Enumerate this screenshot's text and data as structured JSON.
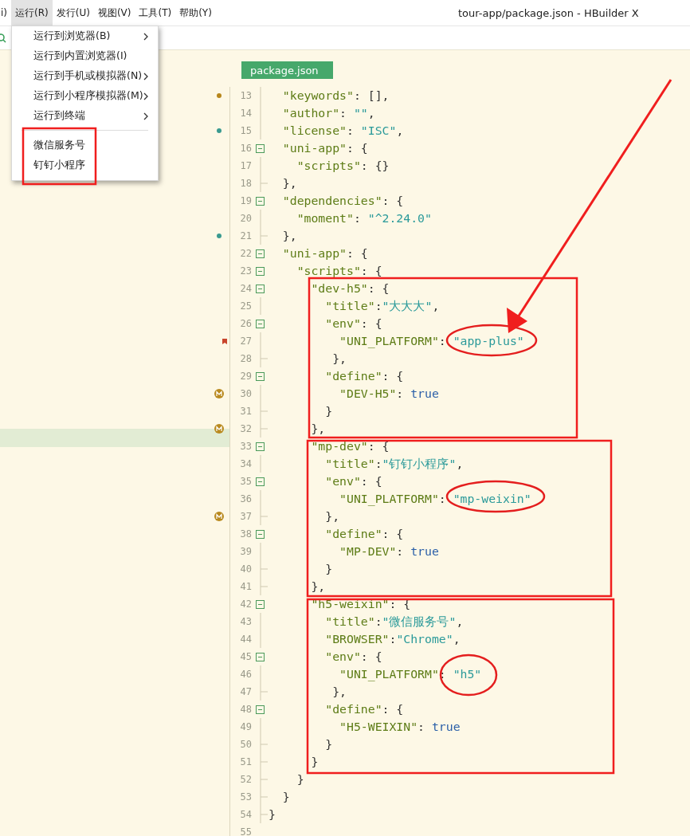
{
  "window": {
    "title": "tour-app/package.json - HBuilder X"
  },
  "menu_bar": [
    {
      "label": "i)",
      "selected": false
    },
    {
      "label": "运行(R)",
      "selected": true
    },
    {
      "label": "发行(U)",
      "selected": false
    },
    {
      "label": "视图(V)",
      "selected": false
    },
    {
      "label": "工具(T)",
      "selected": false
    },
    {
      "label": "帮助(Y)",
      "selected": false
    }
  ],
  "dropdown": {
    "groups": [
      [
        {
          "label": "运行到浏览器(B)",
          "submenu": true
        },
        {
          "label": "运行到内置浏览器(I)",
          "submenu": false
        },
        {
          "label": "运行到手机或模拟器(N)",
          "submenu": true
        },
        {
          "label": "运行到小程序模拟器(M)",
          "submenu": true
        },
        {
          "label": "运行到终端",
          "submenu": true
        }
      ],
      [
        {
          "label": "微信服务号",
          "submenu": false
        },
        {
          "label": "钉钉小程序",
          "submenu": false
        }
      ]
    ]
  },
  "sidebar": {
    "highlighted_row": true
  },
  "editor": {
    "tab": "package.json",
    "lines": [
      {
        "num": "13",
        "fold": {
          "kind": "mid"
        },
        "marker": {
          "kind": "dot",
          "color": "#b7861b"
        },
        "tokens": [
          {
            "kind": "key",
            "text": "  \"keywords\""
          },
          {
            "kind": "punct",
            "text": ": [],"
          }
        ]
      },
      {
        "num": "14",
        "fold": {
          "kind": "mid"
        },
        "tokens": [
          {
            "kind": "key",
            "text": "  \"author\""
          },
          {
            "kind": "punct",
            "text": ": "
          },
          {
            "kind": "str",
            "text": "\"\""
          },
          {
            "kind": "punct",
            "text": ","
          }
        ]
      },
      {
        "num": "15",
        "fold": {
          "kind": "mid"
        },
        "marker": {
          "kind": "dot",
          "color": "#3a9a90"
        },
        "tokens": [
          {
            "kind": "key",
            "text": "  \"license\""
          },
          {
            "kind": "punct",
            "text": ": "
          },
          {
            "kind": "str",
            "text": "\"ISC\""
          },
          {
            "kind": "punct",
            "text": ","
          }
        ]
      },
      {
        "num": "16",
        "fold": {
          "kind": "start"
        },
        "tokens": [
          {
            "kind": "key",
            "text": "  \"uni-app\""
          },
          {
            "kind": "punct",
            "text": ": {"
          }
        ]
      },
      {
        "num": "17",
        "fold": {
          "kind": "mid"
        },
        "tokens": [
          {
            "kind": "key",
            "text": "    \"scripts\""
          },
          {
            "kind": "punct",
            "text": ": {}"
          }
        ]
      },
      {
        "num": "18",
        "fold": {
          "kind": "end"
        },
        "tokens": [
          {
            "kind": "punct",
            "text": "  },"
          }
        ]
      },
      {
        "num": "19",
        "fold": {
          "kind": "start"
        },
        "tokens": [
          {
            "kind": "key",
            "text": "  \"dependencies\""
          },
          {
            "kind": "punct",
            "text": ": {"
          }
        ]
      },
      {
        "num": "20",
        "fold": {
          "kind": "mid"
        },
        "tokens": [
          {
            "kind": "key",
            "text": "    \"moment\""
          },
          {
            "kind": "punct",
            "text": ": "
          },
          {
            "kind": "str",
            "text": "\"^2.24.0\""
          }
        ]
      },
      {
        "num": "21",
        "fold": {
          "kind": "end"
        },
        "marker": {
          "kind": "dot",
          "color": "#3a9a90"
        },
        "tokens": [
          {
            "kind": "punct",
            "text": "  },"
          }
        ]
      },
      {
        "num": "22",
        "fold": {
          "kind": "start"
        },
        "tokens": [
          {
            "kind": "key",
            "text": "  \"uni-app\""
          },
          {
            "kind": "punct",
            "text": ": {"
          }
        ]
      },
      {
        "num": "23",
        "fold": {
          "kind": "start"
        },
        "tokens": [
          {
            "kind": "key",
            "text": "    \"scripts\""
          },
          {
            "kind": "punct",
            "text": ": {"
          }
        ]
      },
      {
        "num": "24",
        "fold": {
          "kind": "start"
        },
        "tokens": [
          {
            "kind": "key",
            "text": "      \"dev-h5\""
          },
          {
            "kind": "punct",
            "text": ": {"
          }
        ]
      },
      {
        "num": "25",
        "fold": {
          "kind": "mid"
        },
        "tokens": [
          {
            "kind": "key",
            "text": "        \"title\""
          },
          {
            "kind": "punct",
            "text": ":"
          },
          {
            "kind": "str",
            "text": "\"大大大\""
          },
          {
            "kind": "punct",
            "text": ","
          }
        ]
      },
      {
        "num": "26",
        "fold": {
          "kind": "start"
        },
        "tokens": [
          {
            "kind": "key",
            "text": "        \"env\""
          },
          {
            "kind": "punct",
            "text": ": {"
          }
        ]
      },
      {
        "num": "27",
        "fold": {
          "kind": "mid"
        },
        "marker": {
          "kind": "bookmark"
        },
        "tokens": [
          {
            "kind": "key",
            "text": "          \"UNI_PLATFORM\""
          },
          {
            "kind": "punct",
            "text": ": "
          },
          {
            "kind": "str",
            "text": "\"app-plus\""
          }
        ]
      },
      {
        "num": "28",
        "fold": {
          "kind": "end"
        },
        "tokens": [
          {
            "kind": "punct",
            "text": "         },"
          }
        ]
      },
      {
        "num": "29",
        "fold": {
          "kind": "start"
        },
        "tokens": [
          {
            "kind": "key",
            "text": "        \"define\""
          },
          {
            "kind": "punct",
            "text": ": {"
          }
        ]
      },
      {
        "num": "30",
        "fold": {
          "kind": "mid"
        },
        "marker": {
          "kind": "modified"
        },
        "tokens": [
          {
            "kind": "key",
            "text": "          \"DEV-H5\""
          },
          {
            "kind": "punct",
            "text": ": "
          },
          {
            "kind": "kw",
            "text": "true"
          }
        ]
      },
      {
        "num": "31",
        "fold": {
          "kind": "end"
        },
        "tokens": [
          {
            "kind": "punct",
            "text": "        }"
          }
        ]
      },
      {
        "num": "32",
        "fold": {
          "kind": "end"
        },
        "marker": {
          "kind": "modified"
        },
        "tokens": [
          {
            "kind": "punct",
            "text": "      },"
          }
        ]
      },
      {
        "num": "33",
        "fold": {
          "kind": "start"
        },
        "tokens": [
          {
            "kind": "key",
            "text": "      \"mp-dev\""
          },
          {
            "kind": "punct",
            "text": ": {"
          }
        ]
      },
      {
        "num": "34",
        "fold": {
          "kind": "mid"
        },
        "tokens": [
          {
            "kind": "key",
            "text": "        \"title\""
          },
          {
            "kind": "punct",
            "text": ":"
          },
          {
            "kind": "str",
            "text": "\"钉钉小程序\""
          },
          {
            "kind": "punct",
            "text": ","
          }
        ]
      },
      {
        "num": "35",
        "fold": {
          "kind": "start"
        },
        "tokens": [
          {
            "kind": "key",
            "text": "        \"env\""
          },
          {
            "kind": "punct",
            "text": ": {"
          }
        ]
      },
      {
        "num": "36",
        "fold": {
          "kind": "mid"
        },
        "tokens": [
          {
            "kind": "key",
            "text": "          \"UNI_PLATFORM\""
          },
          {
            "kind": "punct",
            "text": ": "
          },
          {
            "kind": "str",
            "text": "\"mp-weixin\""
          }
        ]
      },
      {
        "num": "37",
        "fold": {
          "kind": "end"
        },
        "marker": {
          "kind": "modified"
        },
        "tokens": [
          {
            "kind": "punct",
            "text": "        },"
          }
        ]
      },
      {
        "num": "38",
        "fold": {
          "kind": "start"
        },
        "tokens": [
          {
            "kind": "key",
            "text": "        \"define\""
          },
          {
            "kind": "punct",
            "text": ": {"
          }
        ]
      },
      {
        "num": "39",
        "fold": {
          "kind": "mid"
        },
        "tokens": [
          {
            "kind": "key",
            "text": "          \"MP-DEV\""
          },
          {
            "kind": "punct",
            "text": ": "
          },
          {
            "kind": "kw",
            "text": "true"
          }
        ]
      },
      {
        "num": "40",
        "fold": {
          "kind": "end"
        },
        "tokens": [
          {
            "kind": "punct",
            "text": "        }"
          }
        ]
      },
      {
        "num": "41",
        "fold": {
          "kind": "end"
        },
        "tokens": [
          {
            "kind": "punct",
            "text": "      },"
          }
        ]
      },
      {
        "num": "42",
        "fold": {
          "kind": "start"
        },
        "tokens": [
          {
            "kind": "key",
            "text": "      \"h5-weixin\""
          },
          {
            "kind": "punct",
            "text": ": {"
          }
        ]
      },
      {
        "num": "43",
        "fold": {
          "kind": "mid"
        },
        "tokens": [
          {
            "kind": "key",
            "text": "        \"title\""
          },
          {
            "kind": "punct",
            "text": ":"
          },
          {
            "kind": "str",
            "text": "\"微信服务号\""
          },
          {
            "kind": "punct",
            "text": ","
          }
        ]
      },
      {
        "num": "44",
        "fold": {
          "kind": "mid"
        },
        "tokens": [
          {
            "kind": "key",
            "text": "        \"BROWSER\""
          },
          {
            "kind": "punct",
            "text": ":"
          },
          {
            "kind": "str",
            "text": "\"Chrome\""
          },
          {
            "kind": "punct",
            "text": ","
          }
        ]
      },
      {
        "num": "45",
        "fold": {
          "kind": "start"
        },
        "tokens": [
          {
            "kind": "key",
            "text": "        \"env\""
          },
          {
            "kind": "punct",
            "text": ": {"
          }
        ]
      },
      {
        "num": "46",
        "fold": {
          "kind": "mid"
        },
        "tokens": [
          {
            "kind": "key",
            "text": "          \"UNI_PLATFORM\""
          },
          {
            "kind": "punct",
            "text": ": "
          },
          {
            "kind": "str",
            "text": "\"h5\""
          }
        ]
      },
      {
        "num": "47",
        "fold": {
          "kind": "end"
        },
        "tokens": [
          {
            "kind": "punct",
            "text": "         },"
          }
        ]
      },
      {
        "num": "48",
        "fold": {
          "kind": "start"
        },
        "tokens": [
          {
            "kind": "key",
            "text": "        \"define\""
          },
          {
            "kind": "punct",
            "text": ": {"
          }
        ]
      },
      {
        "num": "49",
        "fold": {
          "kind": "mid"
        },
        "tokens": [
          {
            "kind": "key",
            "text": "          \"H5-WEIXIN\""
          },
          {
            "kind": "punct",
            "text": ": "
          },
          {
            "kind": "kw",
            "text": "true"
          }
        ]
      },
      {
        "num": "50",
        "fold": {
          "kind": "end"
        },
        "tokens": [
          {
            "kind": "punct",
            "text": "        }"
          }
        ]
      },
      {
        "num": "51",
        "fold": {
          "kind": "end"
        },
        "tokens": [
          {
            "kind": "punct",
            "text": "      }"
          }
        ]
      },
      {
        "num": "52",
        "fold": {
          "kind": "end"
        },
        "tokens": [
          {
            "kind": "punct",
            "text": "    }"
          }
        ]
      },
      {
        "num": "53",
        "fold": {
          "kind": "end"
        },
        "tokens": [
          {
            "kind": "punct",
            "text": "  }"
          }
        ]
      },
      {
        "num": "54",
        "fold": {
          "kind": "end"
        },
        "tokens": [
          {
            "kind": "punct",
            "text": "}"
          }
        ]
      },
      {
        "num": "55"
      }
    ]
  },
  "annotations": [
    {
      "kind": "frame"
    },
    {
      "kind": "frame"
    },
    {
      "kind": "frame"
    },
    {
      "kind": "frame"
    },
    {
      "kind": "ellipse"
    },
    {
      "kind": "ellipse"
    },
    {
      "kind": "ellipse"
    },
    {
      "kind": "arrow"
    }
  ]
}
